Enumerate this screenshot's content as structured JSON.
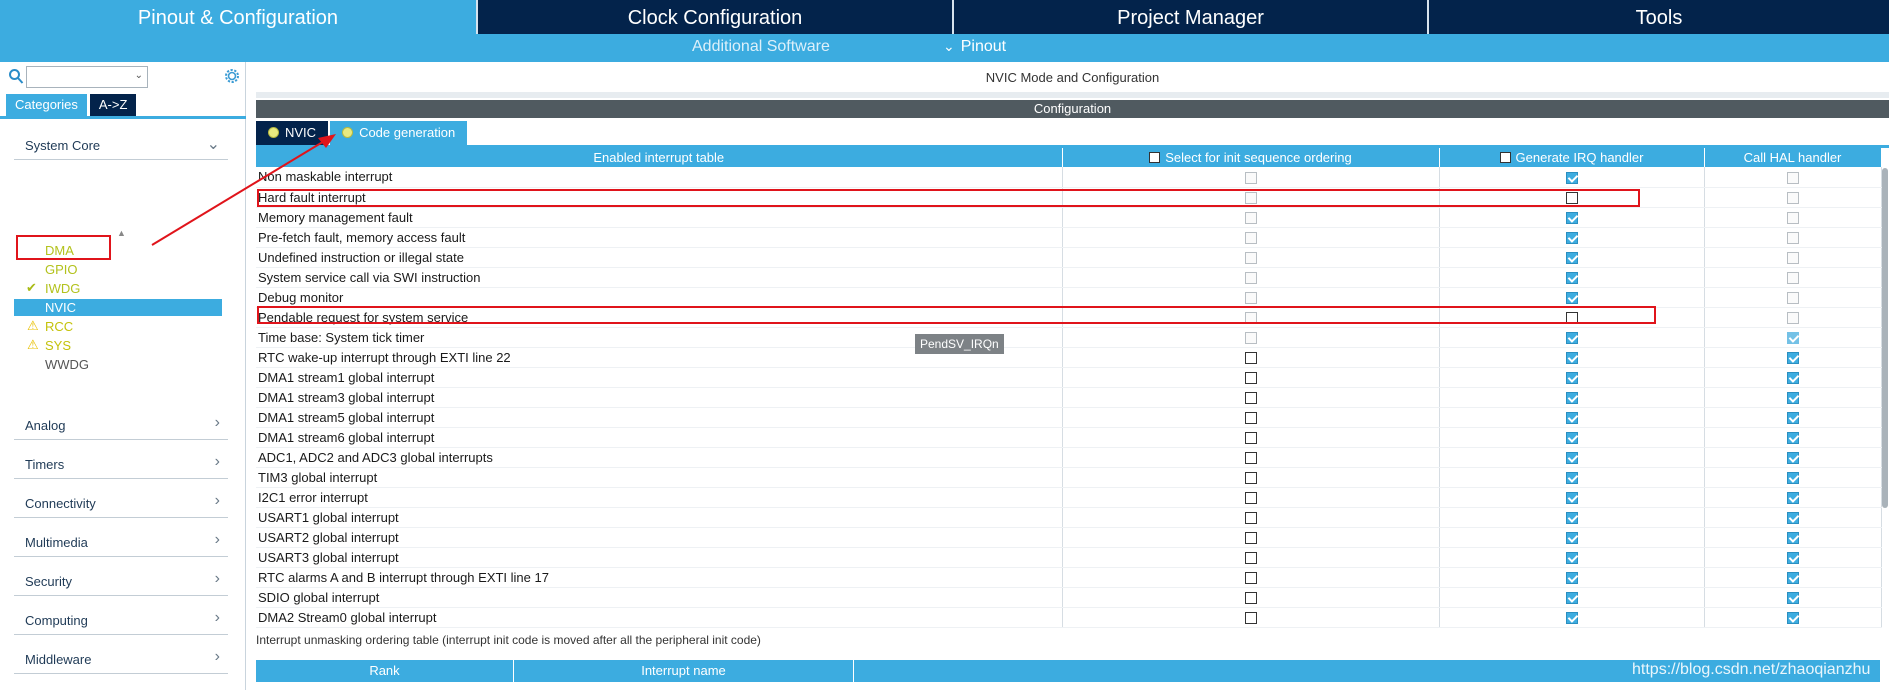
{
  "top_tabs": [
    {
      "label": "Pinout & Configuration",
      "active": true
    },
    {
      "label": "Clock Configuration",
      "active": false
    },
    {
      "label": "Project Manager",
      "active": false
    },
    {
      "label": "Tools",
      "active": false
    }
  ],
  "sub_bar": {
    "additional_software": "Additional Software",
    "pinout": "Pinout"
  },
  "sidebar": {
    "search_placeholder": "",
    "category_tabs": [
      "Categories",
      "A->Z"
    ],
    "groups": {
      "system_core": "System Core",
      "analog": "Analog",
      "timers": "Timers",
      "connectivity": "Connectivity",
      "multimedia": "Multimedia",
      "security": "Security",
      "computing": "Computing",
      "middleware": "Middleware"
    },
    "system_core_items": [
      {
        "label": "DMA",
        "status": "none"
      },
      {
        "label": "GPIO",
        "status": "none"
      },
      {
        "label": "IWDG",
        "status": "ok"
      },
      {
        "label": "NVIC",
        "status": "selected"
      },
      {
        "label": "RCC",
        "status": "warning"
      },
      {
        "label": "SYS",
        "status": "warning"
      },
      {
        "label": "WWDG",
        "status": "plain"
      }
    ]
  },
  "main": {
    "title": "NVIC Mode and Configuration",
    "config_label": "Configuration",
    "tabs": [
      "NVIC",
      "Code generation"
    ],
    "table": {
      "headers": [
        "Enabled interrupt table",
        "Select for init sequence ordering",
        "Generate IRQ handler",
        "Call HAL handler"
      ],
      "rows": [
        [
          "Non maskable interrupt"
        ],
        [
          "Hard fault interrupt"
        ],
        [
          "Memory management fault"
        ],
        [
          "Pre-fetch fault, memory access fault"
        ],
        [
          "Undefined instruction or illegal state"
        ],
        [
          "System service call via SWI instruction"
        ],
        [
          "Debug monitor"
        ],
        [
          "Pendable request for system service"
        ],
        [
          "Time base: System tick timer"
        ],
        [
          "RTC wake-up interrupt through EXTI line 22"
        ],
        [
          "DMA1 stream1 global interrupt"
        ],
        [
          "DMA1 stream3 global interrupt"
        ],
        [
          "DMA1 stream5 global interrupt"
        ],
        [
          "DMA1 stream6 global interrupt"
        ],
        [
          "ADC1, ADC2 and ADC3 global interrupts"
        ],
        [
          "TIM3 global interrupt"
        ],
        [
          "I2C1 error interrupt"
        ],
        [
          "USART1 global interrupt"
        ],
        [
          "USART2 global interrupt"
        ],
        [
          "USART3 global interrupt"
        ],
        [
          "RTC alarms A and B interrupt through EXTI line 17"
        ],
        [
          "SDIO global interrupt"
        ],
        [
          "DMA2 Stream0 global interrupt"
        ]
      ],
      "checks": {
        "init_sequence": [
          "dis",
          "dis",
          "dis",
          "dis",
          "dis",
          "dis",
          "dis",
          "dis",
          "dis",
          "off",
          "off",
          "off",
          "off",
          "off",
          "off",
          "off",
          "off",
          "off",
          "off",
          "off",
          "off",
          "off",
          "off"
        ],
        "generate_irq": [
          "on",
          "off",
          "on",
          "on",
          "on",
          "on",
          "on",
          "off",
          "on",
          "on",
          "on",
          "on",
          "on",
          "on",
          "on",
          "on",
          "on",
          "on",
          "on",
          "on",
          "on",
          "on",
          "on"
        ],
        "call_hal": [
          "dis",
          "dis",
          "dis",
          "dis",
          "dis",
          "dis",
          "dis",
          "dis",
          "ondis",
          "on",
          "on",
          "on",
          "on",
          "on",
          "on",
          "on",
          "on",
          "on",
          "on",
          "on",
          "on",
          "on",
          "on"
        ]
      }
    },
    "tooltip": "PendSV_IRQn",
    "unmask_title": "Interrupt unmasking ordering table (interrupt init code is moved after all the peripheral init code)",
    "bottom_headers": [
      "Rank",
      "Interrupt name"
    ],
    "watermark": "https://blog.csdn.net/zhaoqianzhu"
  },
  "colors": {
    "accent": "#3cace0",
    "dark_tab": "#03234b",
    "annotation": "#e0141b",
    "config_bar": "#505a60"
  }
}
